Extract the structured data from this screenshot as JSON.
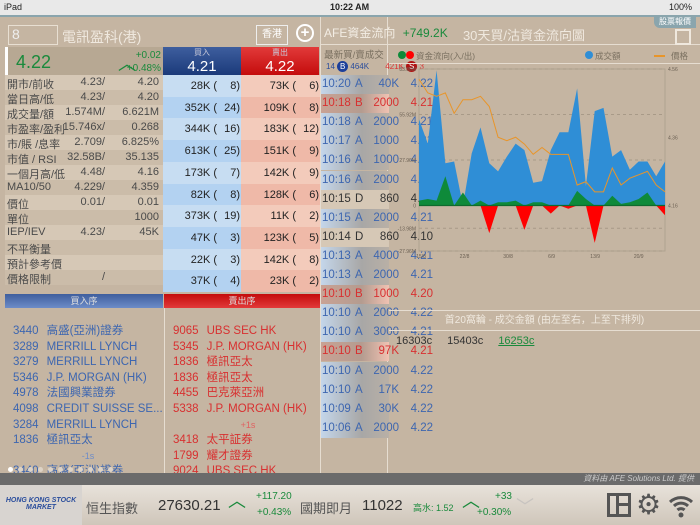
{
  "status": {
    "device": "iPad",
    "time": "10:22 AM",
    "battery": "100%"
  },
  "quote": {
    "code": "8",
    "name": "電訊盈科(港)",
    "market_button": "香港",
    "price": "4.22",
    "change": "+0.02",
    "change_pct": "+0.48%"
  },
  "stats": [
    {
      "label": "開市/前收",
      "a": "4.23/",
      "b": "4.20"
    },
    {
      "label": "當日高/低",
      "a": "4.23/",
      "b": "4.20"
    },
    {
      "label": "成交量/額",
      "a": "1.574M/",
      "b": "6.621M"
    },
    {
      "label": "市盈率/盈利",
      "a": "15.746x/",
      "b": "0.268"
    },
    {
      "label": "市/賬  /息率",
      "a": "2.709/",
      "b": "6.825%"
    },
    {
      "label": "市值 / RSI",
      "a": "32.58B/",
      "b": "35.135"
    },
    {
      "label": "一個月高/低",
      "a": "4.48/",
      "b": "4.16"
    },
    {
      "label": "MA10/50",
      "a": "4.229/",
      "b": "4.359"
    },
    {
      "label": "價位",
      "a": "0.01/",
      "b": "0.01"
    },
    {
      "label": "單位",
      "a": "",
      "b": "1000"
    },
    {
      "label": "IEP/IEV",
      "a": "4.23/",
      "b": "45K"
    },
    {
      "label": "不平衡量",
      "a": "",
      "b": ""
    },
    {
      "label": "預計參考價",
      "a": "",
      "b": ""
    },
    {
      "label": "價格限制",
      "a": "/",
      "b": ""
    }
  ],
  "book": {
    "bid_label": "買入",
    "bid": "4.21",
    "ask_label": "賣出",
    "ask": "4.22",
    "bids": [
      [
        "28K (",
        "8)"
      ],
      [
        "352K (",
        "24)"
      ],
      [
        "344K (",
        "16)"
      ],
      [
        "613K (",
        "25)"
      ],
      [
        "173K (",
        "7)"
      ],
      [
        "82K (",
        "8)"
      ],
      [
        "373K (",
        "19)"
      ],
      [
        "47K (",
        "3)"
      ],
      [
        "22K (",
        "3)"
      ],
      [
        "37K (",
        "4)"
      ]
    ],
    "asks": [
      [
        "73K (",
        "6)"
      ],
      [
        "109K (",
        "8)"
      ],
      [
        "183K (",
        "12)"
      ],
      [
        "151K (",
        "9)"
      ],
      [
        "142K (",
        "9)"
      ],
      [
        "128K (",
        "6)"
      ],
      [
        "11K (",
        "2)"
      ],
      [
        "123K (",
        "5)"
      ],
      [
        "142K (",
        "8)"
      ],
      [
        "23K (",
        "2)"
      ]
    ]
  },
  "queue": {
    "buy_label": "買入序",
    "sell_label": "賣出序",
    "buy": [
      [
        "3440",
        "高盛(亞洲)證券"
      ],
      [
        "3289",
        "MERRILL LYNCH"
      ],
      [
        "3279",
        "MERRILL LYNCH"
      ],
      [
        "5346",
        "J.P. MORGAN (HK)"
      ],
      [
        "4978",
        "法國興業證券"
      ],
      [
        "4098",
        "CREDIT SUISSE SE..."
      ],
      [
        "3284",
        "MERRILL LYNCH"
      ],
      [
        "1836",
        "極訊亞太"
      ],
      [
        "",
        "-1s"
      ],
      [
        "3440",
        "高盛(亞洲)證券"
      ]
    ],
    "sell": [
      [
        "9065",
        "UBS SEC HK"
      ],
      [
        "5345",
        "J.P. MORGAN (HK)"
      ],
      [
        "1836",
        "極訊亞太"
      ],
      [
        "1836",
        "極訊亞太"
      ],
      [
        "4455",
        "巴克萊亞洲"
      ],
      [
        "5338",
        "J.P. MORGAN (HK)"
      ],
      [
        "",
        "+1s"
      ],
      [
        "3418",
        "太平証券"
      ],
      [
        "1799",
        "耀才證券"
      ],
      [
        "9024",
        "UBS SEC HK"
      ]
    ]
  },
  "afe": {
    "label": "AFE資金流向",
    "value": "+749.2K",
    "trades_title": "最新買/賣成交",
    "buy_count": "14",
    "buy_badge": "B",
    "buy_vol": "464K",
    "sell_vol": "421K",
    "sell_badge": "S",
    "sell_count": "3"
  },
  "trades": [
    [
      "10:20",
      "A",
      "40K",
      "4.22"
    ],
    [
      "10:18",
      "B",
      "2000",
      "4.21"
    ],
    [
      "10:18",
      "A",
      "2000",
      "4.21"
    ],
    [
      "10:17",
      "A",
      "1000",
      "4.21"
    ],
    [
      "10:16",
      "A",
      "1000",
      "4.21"
    ],
    [
      "10:16",
      "A",
      "2000",
      "4.21"
    ],
    [
      "10:15",
      "D",
      "860",
      "4.16"
    ],
    [
      "10:15",
      "A",
      "2000",
      "4.21"
    ],
    [
      "10:14",
      "D",
      "860",
      "4.10"
    ],
    [
      "10:13",
      "A",
      "4000",
      "4.21"
    ],
    [
      "10:13",
      "A",
      "2000",
      "4.21"
    ],
    [
      "10:10",
      "B",
      "1000",
      "4.20"
    ],
    [
      "10:10",
      "A",
      "2000",
      "4.22"
    ],
    [
      "10:10",
      "A",
      "3000",
      "4.21"
    ],
    [
      "10:10",
      "B",
      "97K",
      "4.21"
    ],
    [
      "10:10",
      "A",
      "2000",
      "4.22"
    ],
    [
      "10:10",
      "A",
      "17K",
      "4.22"
    ],
    [
      "10:09",
      "A",
      "30K",
      "4.22"
    ],
    [
      "10:06",
      "A",
      "2000",
      "4.22"
    ]
  ],
  "right": {
    "tab_label": "股票報價",
    "title": "30天買/沽資金流向圖",
    "top20_title": "首20窩輪 - 成交金額 (由左至右，上至下排列)",
    "warrants": [
      "16303c",
      "15403c",
      "16253c"
    ]
  },
  "chart_data": {
    "type": "area",
    "title": "30天買/沽資金流向圖",
    "legend": [
      "資金流向(入/出)",
      "成交額",
      "價格"
    ],
    "legend_placement": "top",
    "colors": {
      "inflow": "#0e8a3a",
      "outflow": "#ff0000",
      "volume": "#2f8ed6",
      "price": "#e8952a"
    },
    "y_ticks": [
      "83.88M",
      "55.92M",
      "27.96M",
      "0",
      "-13.98M",
      "-27.96M"
    ],
    "ylim": [
      -27.96,
      83.88
    ],
    "y2_ticks": [
      "4.56",
      "4.36",
      "4.16"
    ],
    "y2lim": [
      4.16,
      4.56
    ],
    "x_ticks": [
      "15/8",
      "22/8",
      "30/8",
      "6/9",
      "13/9",
      "20/9"
    ],
    "volume": [
      53,
      38,
      83,
      26,
      27,
      0,
      32,
      48,
      26,
      21,
      30,
      38,
      34,
      14,
      15,
      34,
      45,
      45,
      72,
      12,
      58,
      60,
      30,
      34,
      22,
      27,
      27,
      18,
      27
    ],
    "flow": [
      3,
      4,
      3,
      18,
      0,
      8,
      0,
      3,
      -17,
      2,
      2,
      3,
      -15,
      2,
      2,
      -5,
      0,
      -2,
      9,
      4,
      -23,
      0,
      6,
      1,
      2,
      4,
      8,
      0,
      -6
    ],
    "price": [
      4.53,
      4.49,
      4.48,
      4.49,
      4.43,
      4.47,
      4.47,
      4.48,
      4.45,
      4.36,
      4.35,
      4.36,
      4.34,
      4.31,
      4.33,
      4.31,
      4.31,
      4.31,
      4.22,
      4.23,
      4.2,
      4.2,
      4.27,
      4.22,
      4.24,
      4.25,
      4.26,
      4.22,
      4.2
    ]
  },
  "footer": {
    "source": "資料由 AFE Solutions Ltd. 提供"
  },
  "ticker": {
    "hsi_label": "恒生指數",
    "hsi": "27630.21",
    "hsi_chg": "+117.20",
    "hsi_pct": "+0.43%",
    "fut_label": "國期即月",
    "fut": "11022",
    "premium": "高水: 1.52",
    "fut_chg": "+33",
    "fut_pct": "+0.30%",
    "logo": "HONG KONG STOCK MARKET"
  }
}
